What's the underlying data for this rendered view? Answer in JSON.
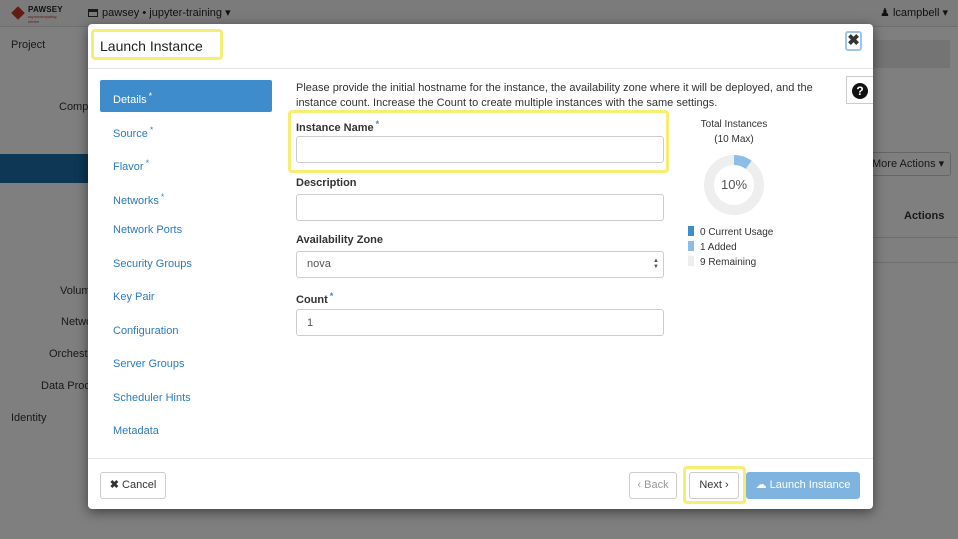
{
  "background": {
    "logo_text": "PAWSEY",
    "logo_subtext": "supercomputing centre",
    "project_selector": "pawsey • jupyter-training",
    "user_menu": "lcampbell",
    "side_labels": [
      "Project",
      "Comp",
      "Volum",
      "Netwo",
      "Orchest",
      "Data Proc",
      "Identity"
    ],
    "more_actions_label": "More Actions",
    "actions_header": "Actions"
  },
  "modal": {
    "title": "Launch Instance",
    "close_icon": "close-icon",
    "help_icon": "question-circle-icon",
    "nav": [
      {
        "label": "Details",
        "required": true,
        "active": true
      },
      {
        "label": "Source",
        "required": true,
        "active": false
      },
      {
        "label": "Flavor",
        "required": true,
        "active": false
      },
      {
        "label": "Networks",
        "required": true,
        "active": false
      },
      {
        "label": "Network Ports",
        "required": false,
        "active": false
      },
      {
        "label": "Security Groups",
        "required": false,
        "active": false
      },
      {
        "label": "Key Pair",
        "required": false,
        "active": false
      },
      {
        "label": "Configuration",
        "required": false,
        "active": false
      },
      {
        "label": "Server Groups",
        "required": false,
        "active": false
      },
      {
        "label": "Scheduler Hints",
        "required": false,
        "active": false
      },
      {
        "label": "Metadata",
        "required": false,
        "active": false
      }
    ],
    "intro_text": "Please provide the initial hostname for the instance, the availability zone where it will be deployed, and the instance count. Increase the Count to create multiple instances with the same settings.",
    "fields": {
      "instance_name_label": "Instance Name",
      "instance_name_value": "",
      "description_label": "Description",
      "description_value": "",
      "availability_zone_label": "Availability Zone",
      "availability_zone_value": "nova",
      "count_label": "Count",
      "count_value": "1"
    },
    "required_marker": "*",
    "chart": {
      "title": "Total Instances",
      "subtitle": "(10 Max)",
      "center_label": "10%",
      "colors": {
        "current": "#3f8ccc",
        "added": "#8bbde6",
        "remaining": "#eeeeee"
      },
      "legend": [
        {
          "label": "0 Current Usage",
          "color": "#3f8ccc"
        },
        {
          "label": "1 Added",
          "color": "#8bbde6"
        },
        {
          "label": "9 Remaining",
          "color": "#eeeeee"
        }
      ]
    },
    "footer": {
      "cancel_label": "Cancel",
      "back_label": "Back",
      "next_label": "Next",
      "launch_label": "Launch Instance"
    }
  },
  "chart_data": {
    "type": "pie",
    "categories": [
      "Current Usage",
      "Added",
      "Remaining"
    ],
    "values": [
      0,
      1,
      9
    ],
    "title": "Total Instances",
    "subtitle": "(10 Max)"
  }
}
